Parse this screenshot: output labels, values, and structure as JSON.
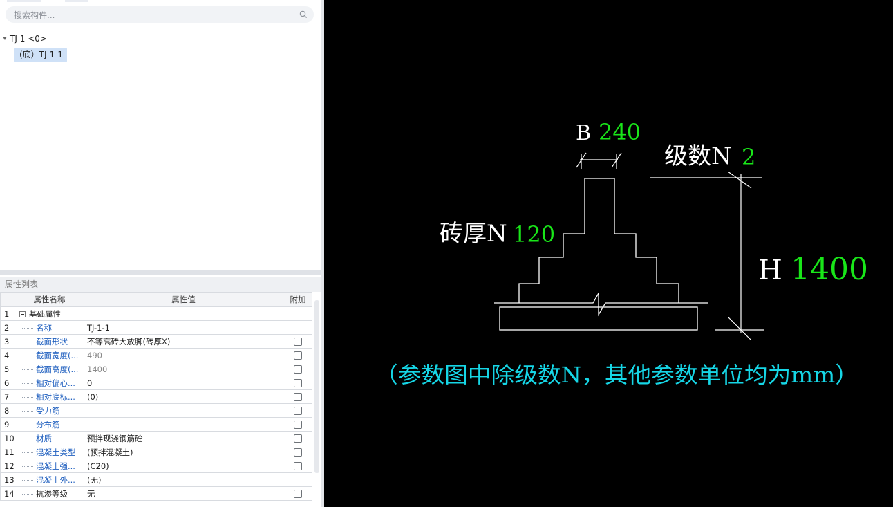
{
  "search": {
    "placeholder": "搜索构件..."
  },
  "tree": {
    "root_label": "TJ-1 <0>",
    "child_label": "(底）TJ-1-1"
  },
  "properties": {
    "title": "属性列表",
    "headers": {
      "name": "属性名称",
      "value": "属性值",
      "extra": "附加"
    },
    "rows": [
      {
        "idx": "1",
        "name": "基础属性",
        "value": "",
        "group": true,
        "checkbox": false
      },
      {
        "idx": "2",
        "name": "名称",
        "value": "TJ-1-1",
        "checkbox": false
      },
      {
        "idx": "3",
        "name": "截面形状",
        "value": "不等高砖大放脚(砖厚X)",
        "checkbox": true
      },
      {
        "idx": "4",
        "name": "截面宽度(...",
        "value": "490",
        "gray": true,
        "checkbox": true
      },
      {
        "idx": "5",
        "name": "截面高度(...",
        "value": "1400",
        "gray": true,
        "checkbox": true
      },
      {
        "idx": "6",
        "name": "相对偏心...",
        "value": "0",
        "checkbox": true
      },
      {
        "idx": "7",
        "name": "相对底标...",
        "value": "(0)",
        "checkbox": true
      },
      {
        "idx": "8",
        "name": "受力筋",
        "value": "",
        "checkbox": true
      },
      {
        "idx": "9",
        "name": "分布筋",
        "value": "",
        "checkbox": true
      },
      {
        "idx": "10",
        "name": "材质",
        "value": "预拌现浇钢筋砼",
        "checkbox": true
      },
      {
        "idx": "11",
        "name": "混凝土类型",
        "value": "(预拌混凝土)",
        "checkbox": true
      },
      {
        "idx": "12",
        "name": "混凝土强...",
        "value": "(C20)",
        "checkbox": true
      },
      {
        "idx": "13",
        "name": "混凝土外...",
        "value": "(无)",
        "checkbox": false
      },
      {
        "idx": "14",
        "name": "抗渗等级",
        "value": "无",
        "black": true,
        "checkbox": true
      }
    ]
  },
  "diagram": {
    "b_label": "B",
    "b_value": "240",
    "levels_label": "级数N",
    "levels_value": "2",
    "brick_label": "砖厚N",
    "brick_value": "120",
    "h_label": "H",
    "h_value": "1400",
    "note": "（参数图中除级数N，其他参数单位均为mm）",
    "colors": {
      "white": "#ffffff",
      "green": "#19e619",
      "cyan": "#16d6e6",
      "background": "#000000"
    }
  }
}
